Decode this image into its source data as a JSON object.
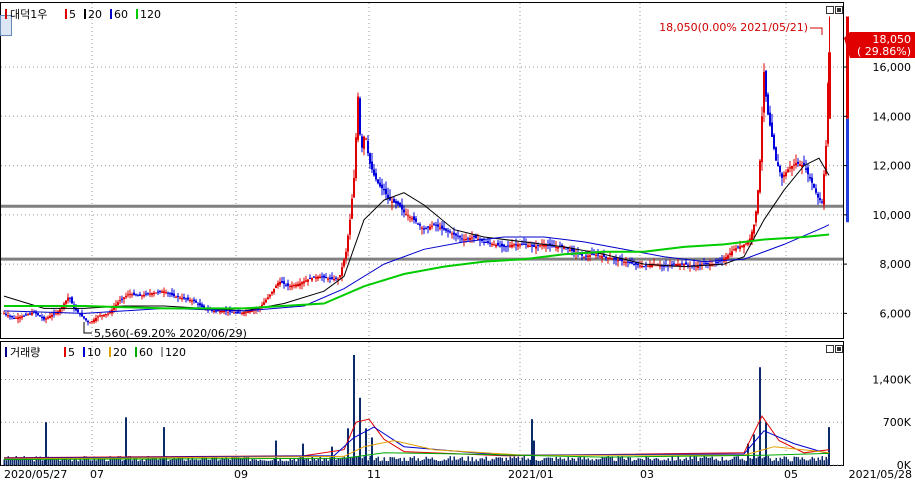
{
  "chart_data": [
    {
      "type": "candlestick",
      "legend": {
        "title": "대덕1우",
        "items": [
          {
            "label": "5",
            "color": "#e00000"
          },
          {
            "label": "20",
            "color": "#000000"
          },
          {
            "label": "60",
            "color": "#0000cc"
          },
          {
            "label": "120",
            "color": "#00cc00"
          }
        ]
      },
      "ylim": [
        5000,
        18600
      ],
      "yticks": [
        {
          "value": 6000,
          "label": "6,000"
        },
        {
          "value": 8000,
          "label": "8,000"
        },
        {
          "value": 10000,
          "label": "10,000"
        },
        {
          "value": 12000,
          "label": "12,000"
        },
        {
          "value": 14000,
          "label": "14,000"
        },
        {
          "value": 16000,
          "label": "16,000"
        }
      ],
      "current_price": {
        "label": "18,050",
        "change": "( 29.86%)",
        "value": 18050
      },
      "annotations": {
        "high": {
          "text": "18,050(0.00% 2021/05/21)",
          "value": 18050
        },
        "low": {
          "text": "5,560(-69.20% 2020/06/29)",
          "value": 5560
        }
      },
      "horizontal_lines": [
        10350,
        8200
      ],
      "price_path": [
        [
          0,
          6000
        ],
        [
          10,
          5800
        ],
        [
          20,
          5900
        ],
        [
          30,
          6050
        ],
        [
          40,
          5750
        ],
        [
          55,
          6100
        ],
        [
          65,
          6700
        ],
        [
          70,
          6200
        ],
        [
          80,
          5800
        ],
        [
          85,
          5600
        ],
        [
          95,
          5900
        ],
        [
          105,
          6000
        ],
        [
          115,
          6500
        ],
        [
          125,
          6800
        ],
        [
          135,
          6700
        ],
        [
          145,
          6800
        ],
        [
          160,
          6900
        ],
        [
          170,
          6700
        ],
        [
          180,
          6600
        ],
        [
          190,
          6500
        ],
        [
          200,
          6200
        ],
        [
          210,
          6100
        ],
        [
          220,
          6100
        ],
        [
          235,
          6000
        ],
        [
          245,
          6100
        ],
        [
          255,
          6200
        ],
        [
          265,
          6700
        ],
        [
          275,
          7300
        ],
        [
          285,
          7100
        ],
        [
          295,
          7200
        ],
        [
          305,
          7400
        ],
        [
          315,
          7500
        ],
        [
          325,
          7400
        ],
        [
          335,
          7400
        ],
        [
          342,
          8500
        ],
        [
          346,
          9800
        ],
        [
          350,
          11500
        ],
        [
          354,
          14800
        ],
        [
          357,
          12500
        ],
        [
          361,
          13400
        ],
        [
          365,
          12200
        ],
        [
          370,
          11600
        ],
        [
          375,
          11200
        ],
        [
          380,
          11000
        ],
        [
          385,
          10600
        ],
        [
          390,
          10500
        ],
        [
          395,
          10400
        ],
        [
          400,
          10100
        ],
        [
          410,
          9800
        ],
        [
          420,
          9400
        ],
        [
          430,
          9600
        ],
        [
          440,
          9400
        ],
        [
          450,
          9200
        ],
        [
          460,
          9000
        ],
        [
          470,
          9100
        ],
        [
          480,
          8900
        ],
        [
          490,
          8800
        ],
        [
          500,
          8700
        ],
        [
          510,
          8800
        ],
        [
          520,
          8800
        ],
        [
          530,
          8700
        ],
        [
          540,
          8800
        ],
        [
          550,
          8700
        ],
        [
          560,
          8700
        ],
        [
          570,
          8500
        ],
        [
          580,
          8300
        ],
        [
          590,
          8400
        ],
        [
          600,
          8300
        ],
        [
          610,
          8200
        ],
        [
          620,
          8100
        ],
        [
          630,
          8000
        ],
        [
          640,
          7900
        ],
        [
          650,
          8000
        ],
        [
          660,
          7900
        ],
        [
          670,
          8000
        ],
        [
          680,
          8000
        ],
        [
          690,
          7900
        ],
        [
          700,
          8000
        ],
        [
          710,
          8000
        ],
        [
          720,
          8200
        ],
        [
          730,
          8600
        ],
        [
          740,
          8800
        ],
        [
          745,
          8900
        ],
        [
          750,
          9600
        ],
        [
          753,
          10400
        ],
        [
          756,
          12200
        ],
        [
          760,
          15800
        ],
        [
          763,
          14300
        ],
        [
          767,
          13400
        ],
        [
          772,
          12200
        ],
        [
          778,
          11500
        ],
        [
          785,
          11900
        ],
        [
          792,
          12100
        ],
        [
          800,
          12000
        ],
        [
          808,
          11300
        ],
        [
          814,
          10700
        ],
        [
          818,
          10500
        ],
        [
          822,
          12800
        ],
        [
          825,
          16600
        ]
      ],
      "ma_overlays": [
        {
          "name": "20",
          "color": "#000000",
          "path": [
            [
              0,
              6700
            ],
            [
              40,
              6200
            ],
            [
              80,
              6200
            ],
            [
              120,
              6300
            ],
            [
              160,
              6300
            ],
            [
              200,
              6200
            ],
            [
              240,
              6100
            ],
            [
              280,
              6400
            ],
            [
              320,
              6900
            ],
            [
              340,
              7500
            ],
            [
              360,
              9800
            ],
            [
              380,
              10600
            ],
            [
              400,
              10900
            ],
            [
              420,
              10400
            ],
            [
              450,
              9400
            ],
            [
              480,
              9100
            ],
            [
              520,
              8900
            ],
            [
              560,
              8700
            ],
            [
              600,
              8400
            ],
            [
              640,
              8000
            ],
            [
              680,
              7900
            ],
            [
              720,
              8000
            ],
            [
              740,
              8300
            ],
            [
              760,
              9800
            ],
            [
              780,
              11000
            ],
            [
              800,
              12000
            ],
            [
              815,
              12300
            ],
            [
              825,
              11600
            ]
          ]
        },
        {
          "name": "60",
          "color": "#0000cc",
          "path": [
            [
              0,
              6100
            ],
            [
              80,
              6000
            ],
            [
              160,
              6200
            ],
            [
              240,
              6100
            ],
            [
              300,
              6300
            ],
            [
              340,
              7000
            ],
            [
              380,
              8000
            ],
            [
              420,
              8600
            ],
            [
              460,
              8900
            ],
            [
              500,
              9100
            ],
            [
              540,
              9100
            ],
            [
              580,
              8900
            ],
            [
              620,
              8600
            ],
            [
              660,
              8300
            ],
            [
              700,
              8100
            ],
            [
              740,
              8200
            ],
            [
              780,
              8800
            ],
            [
              820,
              9500
            ],
            [
              825,
              9600
            ]
          ]
        },
        {
          "name": "120",
          "color": "#00cc00",
          "path": [
            [
              0,
              6300
            ],
            [
              80,
              6300
            ],
            [
              160,
              6200
            ],
            [
              240,
              6200
            ],
            [
              320,
              6400
            ],
            [
              360,
              7100
            ],
            [
              400,
              7600
            ],
            [
              440,
              7900
            ],
            [
              480,
              8100
            ],
            [
              520,
              8200
            ],
            [
              560,
              8400
            ],
            [
              600,
              8500
            ],
            [
              640,
              8500
            ],
            [
              680,
              8700
            ],
            [
              720,
              8800
            ],
            [
              760,
              9000
            ],
            [
              800,
              9100
            ],
            [
              825,
              9200
            ]
          ]
        }
      ]
    },
    {
      "type": "bar",
      "legend": {
        "title": "거래량",
        "items": [
          {
            "label": "5",
            "color": "#e00000"
          },
          {
            "label": "10",
            "color": "#0000cc"
          },
          {
            "label": "20",
            "color": "#e0a000"
          },
          {
            "label": "60",
            "color": "#00aa00"
          },
          {
            "label": "120",
            "color": "#999999"
          }
        ]
      },
      "ylim": [
        0,
        1800000
      ],
      "yticks": [
        {
          "value": 0,
          "label": "0K"
        },
        {
          "value": 700000,
          "label": "700K"
        },
        {
          "value": 1400000,
          "label": "1,400K"
        }
      ],
      "spikes": [
        [
          42,
          700000
        ],
        [
          122,
          780000
        ],
        [
          160,
          620000
        ],
        [
          272,
          400000
        ],
        [
          299,
          350000
        ],
        [
          328,
          300000
        ],
        [
          344,
          600000
        ],
        [
          350,
          1800000
        ],
        [
          356,
          1100000
        ],
        [
          362,
          600000
        ],
        [
          368,
          450000
        ],
        [
          528,
          750000
        ],
        [
          530,
          400000
        ],
        [
          744,
          350000
        ],
        [
          750,
          500000
        ],
        [
          756,
          1600000
        ],
        [
          762,
          700000
        ],
        [
          825,
          620000
        ]
      ],
      "x_axis": {
        "ticks": [
          {
            "label": "2020/05/27"
          },
          {
            "label": "07"
          },
          {
            "label": "09"
          },
          {
            "label": "11"
          },
          {
            "label": "2021/01"
          },
          {
            "label": "03"
          },
          {
            "label": "05"
          }
        ],
        "end_label": "2021/05/28"
      }
    }
  ]
}
